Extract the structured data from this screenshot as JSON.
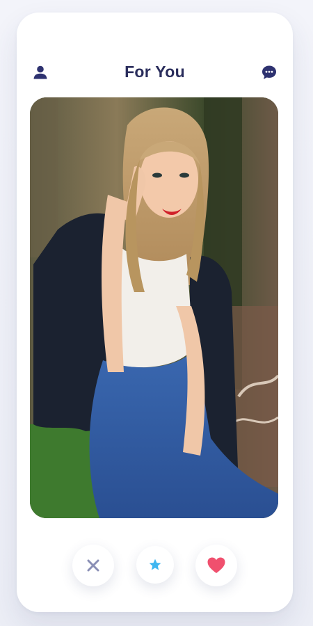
{
  "header": {
    "title": "For You",
    "profile_icon": "user-icon",
    "chat_icon": "chat-bubble-icon"
  },
  "card": {
    "image_description_icon": "profile-photo"
  },
  "actions": {
    "dislike_icon": "close-icon",
    "superlike_icon": "star-icon",
    "like_icon": "heart-icon"
  },
  "colors": {
    "title": "#2a2d5c",
    "icon_dark": "#2e3270",
    "dislike": "#8a8fb5",
    "superlike": "#3fb6f0",
    "like": "#f0506e"
  }
}
